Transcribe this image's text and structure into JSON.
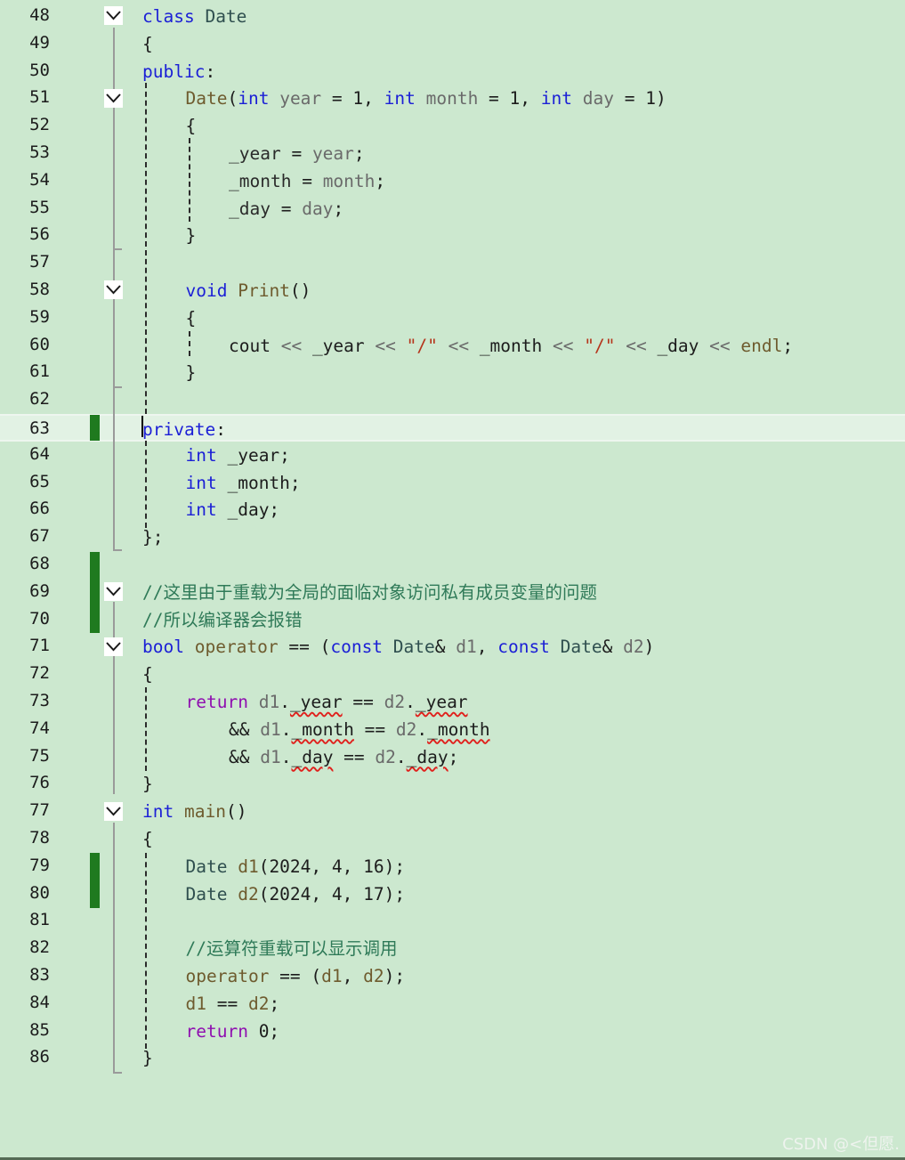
{
  "editor": {
    "lines": [
      {
        "n": "48",
        "tokens": [
          {
            "t": "class",
            "c": "kw"
          },
          {
            "t": " "
          },
          {
            "t": "Date",
            "c": "ty"
          }
        ]
      },
      {
        "n": "49",
        "tokens": [
          {
            "t": "{"
          }
        ]
      },
      {
        "n": "50",
        "tokens": [
          {
            "t": "public",
            "c": "kw"
          },
          {
            "t": ":"
          }
        ]
      },
      {
        "n": "51",
        "tokens": [
          {
            "t": "Date",
            "c": "fn"
          },
          {
            "t": "("
          },
          {
            "t": "int",
            "c": "kw"
          },
          {
            "t": " "
          },
          {
            "t": "year",
            "c": "pm"
          },
          {
            "t": " = 1, "
          },
          {
            "t": "int",
            "c": "kw"
          },
          {
            "t": " "
          },
          {
            "t": "month",
            "c": "pm"
          },
          {
            "t": " = 1, "
          },
          {
            "t": "int",
            "c": "kw"
          },
          {
            "t": " "
          },
          {
            "t": "day",
            "c": "pm"
          },
          {
            "t": " = 1)"
          }
        ]
      },
      {
        "n": "52",
        "tokens": [
          {
            "t": "{"
          }
        ]
      },
      {
        "n": "53",
        "tokens": [
          {
            "t": "_year",
            "c": "mem"
          },
          {
            "t": " = "
          },
          {
            "t": "year",
            "c": "pm"
          },
          {
            "t": ";"
          }
        ]
      },
      {
        "n": "54",
        "tokens": [
          {
            "t": "_month",
            "c": "mem"
          },
          {
            "t": " = "
          },
          {
            "t": "month",
            "c": "pm"
          },
          {
            "t": ";"
          }
        ]
      },
      {
        "n": "55",
        "tokens": [
          {
            "t": "_day",
            "c": "mem"
          },
          {
            "t": " = "
          },
          {
            "t": "day",
            "c": "pm"
          },
          {
            "t": ";"
          }
        ]
      },
      {
        "n": "56",
        "tokens": [
          {
            "t": "}"
          }
        ]
      },
      {
        "n": "57",
        "tokens": []
      },
      {
        "n": "58",
        "tokens": [
          {
            "t": "void",
            "c": "kw"
          },
          {
            "t": " "
          },
          {
            "t": "Print",
            "c": "fn"
          },
          {
            "t": "()"
          }
        ]
      },
      {
        "n": "59",
        "tokens": [
          {
            "t": "{"
          }
        ]
      },
      {
        "n": "60",
        "tokens": [
          {
            "t": "cout"
          },
          {
            "t": " << ",
            "c": "pm"
          },
          {
            "t": "_year"
          },
          {
            "t": " << ",
            "c": "pm"
          },
          {
            "t": "\"/\"",
            "c": "st"
          },
          {
            "t": " << ",
            "c": "pm"
          },
          {
            "t": "_month"
          },
          {
            "t": " << ",
            "c": "pm"
          },
          {
            "t": "\"/\"",
            "c": "st"
          },
          {
            "t": " << ",
            "c": "pm"
          },
          {
            "t": "_day"
          },
          {
            "t": " << ",
            "c": "pm"
          },
          {
            "t": "endl",
            "c": "fn"
          },
          {
            "t": ";"
          }
        ]
      },
      {
        "n": "61",
        "tokens": [
          {
            "t": "}"
          }
        ]
      },
      {
        "n": "62",
        "tokens": []
      },
      {
        "n": "63",
        "tokens": [
          {
            "t": "private",
            "c": "kw"
          },
          {
            "t": ":"
          }
        ]
      },
      {
        "n": "64",
        "tokens": [
          {
            "t": "int",
            "c": "kw"
          },
          {
            "t": " _year;"
          }
        ]
      },
      {
        "n": "65",
        "tokens": [
          {
            "t": "int",
            "c": "kw"
          },
          {
            "t": " _month;"
          }
        ]
      },
      {
        "n": "66",
        "tokens": [
          {
            "t": "int",
            "c": "kw"
          },
          {
            "t": " _day;"
          }
        ]
      },
      {
        "n": "67",
        "tokens": [
          {
            "t": "};"
          }
        ]
      },
      {
        "n": "68",
        "tokens": []
      },
      {
        "n": "69",
        "tokens": [
          {
            "t": "//这里由于重载为全局的面临对象访问私有成员变量的问题",
            "c": "cm"
          }
        ]
      },
      {
        "n": "70",
        "tokens": [
          {
            "t": "//所以编译器会报错",
            "c": "cm"
          }
        ]
      },
      {
        "n": "71",
        "tokens": [
          {
            "t": "bool",
            "c": "kw"
          },
          {
            "t": " "
          },
          {
            "t": "operator",
            "c": "fn"
          },
          {
            "t": " == ("
          },
          {
            "t": "const",
            "c": "kw"
          },
          {
            "t": " "
          },
          {
            "t": "Date",
            "c": "ty"
          },
          {
            "t": "& "
          },
          {
            "t": "d1",
            "c": "pm"
          },
          {
            "t": ", "
          },
          {
            "t": "const",
            "c": "kw"
          },
          {
            "t": " "
          },
          {
            "t": "Date",
            "c": "ty"
          },
          {
            "t": "& "
          },
          {
            "t": "d2",
            "c": "pm"
          },
          {
            "t": ")"
          }
        ]
      },
      {
        "n": "72",
        "tokens": [
          {
            "t": "{"
          }
        ]
      },
      {
        "n": "73",
        "tokens": [
          {
            "t": "return",
            "c": "ctl"
          },
          {
            "t": " "
          },
          {
            "t": "d1",
            "c": "pm"
          },
          {
            "t": "."
          },
          {
            "t": "_year",
            "c": "sq"
          },
          {
            "t": " == "
          },
          {
            "t": "d2",
            "c": "pm"
          },
          {
            "t": "."
          },
          {
            "t": "_year",
            "c": "sq"
          }
        ]
      },
      {
        "n": "74",
        "tokens": [
          {
            "t": "&& "
          },
          {
            "t": "d1",
            "c": "pm"
          },
          {
            "t": "."
          },
          {
            "t": "_month",
            "c": "sq"
          },
          {
            "t": " == "
          },
          {
            "t": "d2",
            "c": "pm"
          },
          {
            "t": "."
          },
          {
            "t": "_month",
            "c": "sq"
          }
        ]
      },
      {
        "n": "75",
        "tokens": [
          {
            "t": "&& "
          },
          {
            "t": "d1",
            "c": "pm"
          },
          {
            "t": "."
          },
          {
            "t": "_day",
            "c": "sq"
          },
          {
            "t": " == "
          },
          {
            "t": "d2",
            "c": "pm"
          },
          {
            "t": "."
          },
          {
            "t": "_day",
            "c": "sq"
          },
          {
            "t": ";"
          }
        ]
      },
      {
        "n": "76",
        "tokens": [
          {
            "t": "}"
          }
        ]
      },
      {
        "n": "77",
        "tokens": [
          {
            "t": "int",
            "c": "kw"
          },
          {
            "t": " "
          },
          {
            "t": "main",
            "c": "fn"
          },
          {
            "t": "()"
          }
        ]
      },
      {
        "n": "78",
        "tokens": [
          {
            "t": "{"
          }
        ]
      },
      {
        "n": "79",
        "tokens": [
          {
            "t": "Date",
            "c": "ty"
          },
          {
            "t": " "
          },
          {
            "t": "d1",
            "c": "fn"
          },
          {
            "t": "(2024, 4, 16);"
          }
        ]
      },
      {
        "n": "80",
        "tokens": [
          {
            "t": "Date",
            "c": "ty"
          },
          {
            "t": " "
          },
          {
            "t": "d2",
            "c": "fn"
          },
          {
            "t": "(2024, 4, 17);"
          }
        ]
      },
      {
        "n": "81",
        "tokens": []
      },
      {
        "n": "82",
        "tokens": [
          {
            "t": "//运算符重载可以显示调用",
            "c": "cm"
          }
        ]
      },
      {
        "n": "83",
        "tokens": [
          {
            "t": "operator",
            "c": "fn"
          },
          {
            "t": " == ("
          },
          {
            "t": "d1",
            "c": "fn"
          },
          {
            "t": ", "
          },
          {
            "t": "d2",
            "c": "fn"
          },
          {
            "t": ");"
          }
        ]
      },
      {
        "n": "84",
        "tokens": [
          {
            "t": "d1",
            "c": "fn"
          },
          {
            "t": " == "
          },
          {
            "t": "d2",
            "c": "fn"
          },
          {
            "t": ";"
          }
        ]
      },
      {
        "n": "85",
        "tokens": [
          {
            "t": "return",
            "c": "ctl"
          },
          {
            "t": " 0;"
          }
        ]
      },
      {
        "n": "86",
        "tokens": [
          {
            "t": "}"
          }
        ]
      }
    ]
  },
  "watermark": "CSDN @<但愿.",
  "icons": {
    "fold": "chevron-down-icon"
  },
  "colors": {
    "background": "#cce8cf",
    "keyword": "#1b1fd6",
    "control": "#8f0fb0",
    "comment": "#2f7a58",
    "string": "#b5341b",
    "change_bar": "#1f7a1f",
    "error_squiggle": "#e0201c"
  }
}
